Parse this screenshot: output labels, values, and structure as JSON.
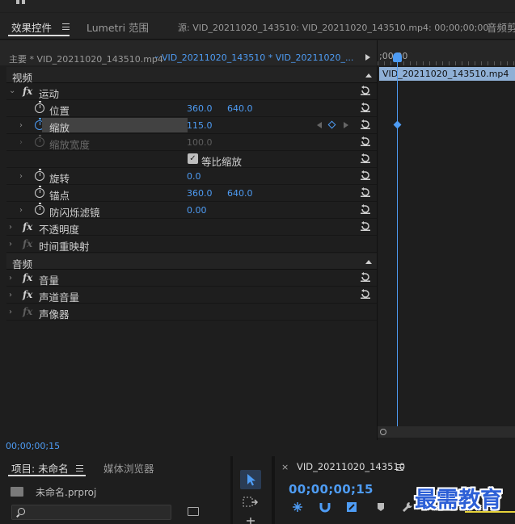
{
  "header": {
    "tabs": [
      {
        "label": "效果控件",
        "active": true
      },
      {
        "label": "Lumetri 范围",
        "active": false
      },
      {
        "label": "源: VID_20211020_143510: VID_20211020_143510.mp4: 00;00;00;00",
        "active": false
      },
      {
        "label": "音频剪",
        "active": false
      }
    ]
  },
  "clip_bar": {
    "master": "主要 * VID_20211020_143510.mp4",
    "sequence": "VID_20211020_143510 * VID_20211020_..."
  },
  "sections": {
    "video": "视频",
    "audio": "音频"
  },
  "effects": {
    "motion": "运动",
    "position": {
      "label": "位置",
      "x": "360.0",
      "y": "640.0"
    },
    "scale": {
      "label": "缩放",
      "value": "115.0"
    },
    "scale_width": {
      "label": "缩放宽度",
      "value": "100.0"
    },
    "uniform_scale": {
      "label": "等比缩放",
      "checked": true
    },
    "rotation": {
      "label": "旋转",
      "value": "0.0"
    },
    "anchor": {
      "label": "锚点",
      "x": "360.0",
      "y": "640.0"
    },
    "anti_flicker": {
      "label": "防闪烁滤镜",
      "value": "0.00"
    },
    "opacity": "不透明度",
    "time_remap": "时间重映射",
    "volume": "音量",
    "channel_volume": "声道音量",
    "panner": "声像器"
  },
  "timeline": {
    "timecode": ";00;00",
    "clip_name": "VID_20211020_143510.mp4"
  },
  "status_timecode": "00;00;00;15",
  "project": {
    "title": "项目: 未命名",
    "tab2": "媒体浏览器",
    "file": "未命名.prproj"
  },
  "sequence_panel": {
    "close": "×",
    "title": "VID_20211020_143510",
    "timecode": "00;00;00;15"
  },
  "watermark": "最需教育",
  "colors": {
    "accent": "#4e9cf4",
    "clip": "#8fb0d6"
  }
}
